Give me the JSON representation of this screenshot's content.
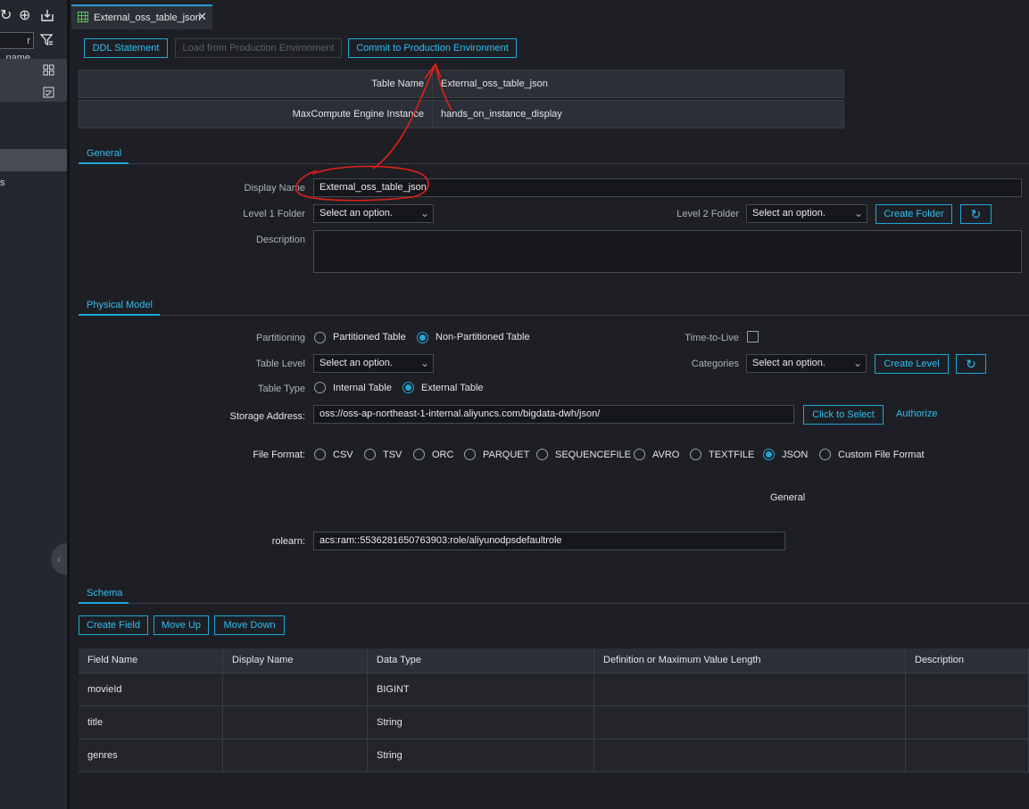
{
  "sidebar": {
    "search_placeholder": "r name",
    "partial_text": "s"
  },
  "tab": {
    "title": "External_oss_table_json"
  },
  "toolbar": {
    "ddl": "DDL Statement",
    "load": "Load from Production Environment",
    "commit": "Commit to Production Environment"
  },
  "info": {
    "table_name_label": "Table Name",
    "table_name_value": "External_oss_table_json",
    "instance_label": "MaxCompute Engine Instance",
    "instance_value": "hands_on_instance_display"
  },
  "general": {
    "section": "General",
    "display_name_label": "Display Name",
    "display_name_value": "External_oss_table_json",
    "level1_label": "Level 1 Folder",
    "level1_value": "Select an option.",
    "level2_label": "Level 2 Folder",
    "level2_value": "Select an option.",
    "create_folder": "Create Folder",
    "description_label": "Description"
  },
  "physical": {
    "section": "Physical Model",
    "partitioning_label": "Partitioning",
    "partitioned": "Partitioned Table",
    "non_partitioned": "Non-Partitioned Table",
    "ttl_label": "Time-to-Live",
    "table_level_label": "Table Level",
    "table_level_value": "Select an option.",
    "categories_label": "Categories",
    "categories_value": "Select an option.",
    "create_level": "Create Level",
    "table_type_label": "Table Type",
    "internal": "Internal Table",
    "external": "External Table",
    "storage_label": "Storage Address:",
    "storage_value": "oss://oss-ap-northeast-1-internal.aliyuncs.com/bigdata-dwh/json/",
    "click_select": "Click to Select",
    "authorize": "Authorize",
    "file_format_label": "File Format:",
    "formats": [
      "CSV",
      "TSV",
      "ORC",
      "PARQUET",
      "SEQUENCEFILE",
      "AVRO",
      "TEXTFILE",
      "JSON",
      "Custom File Format"
    ],
    "selected_format": "JSON",
    "general_sub": "General",
    "rolearn_label": "rolearn:",
    "rolearn_value": "acs:ram::5536281650763903:role/aliyunodpsdefaultrole"
  },
  "schema": {
    "section": "Schema",
    "create_field": "Create Field",
    "move_up": "Move Up",
    "move_down": "Move Down",
    "headers": [
      "Field Name",
      "Display Name",
      "Data Type",
      "Definition or Maximum Value Length",
      "Description"
    ],
    "rows": [
      [
        "movieId",
        "",
        "BIGINT",
        "",
        ""
      ],
      [
        "title",
        "",
        "String",
        "",
        ""
      ],
      [
        "genres",
        "",
        "String",
        "",
        ""
      ]
    ]
  },
  "colors": {
    "accent": "#22a6d8",
    "annotation": "#e0201c",
    "background": "#1d1f24"
  },
  "icons": [
    "refresh-icon",
    "locate-icon",
    "import-icon",
    "filter-icon",
    "grid-icon",
    "checklist-icon",
    "table-icon",
    "close-icon",
    "chevron-down-icon",
    "collapse-icon"
  ]
}
